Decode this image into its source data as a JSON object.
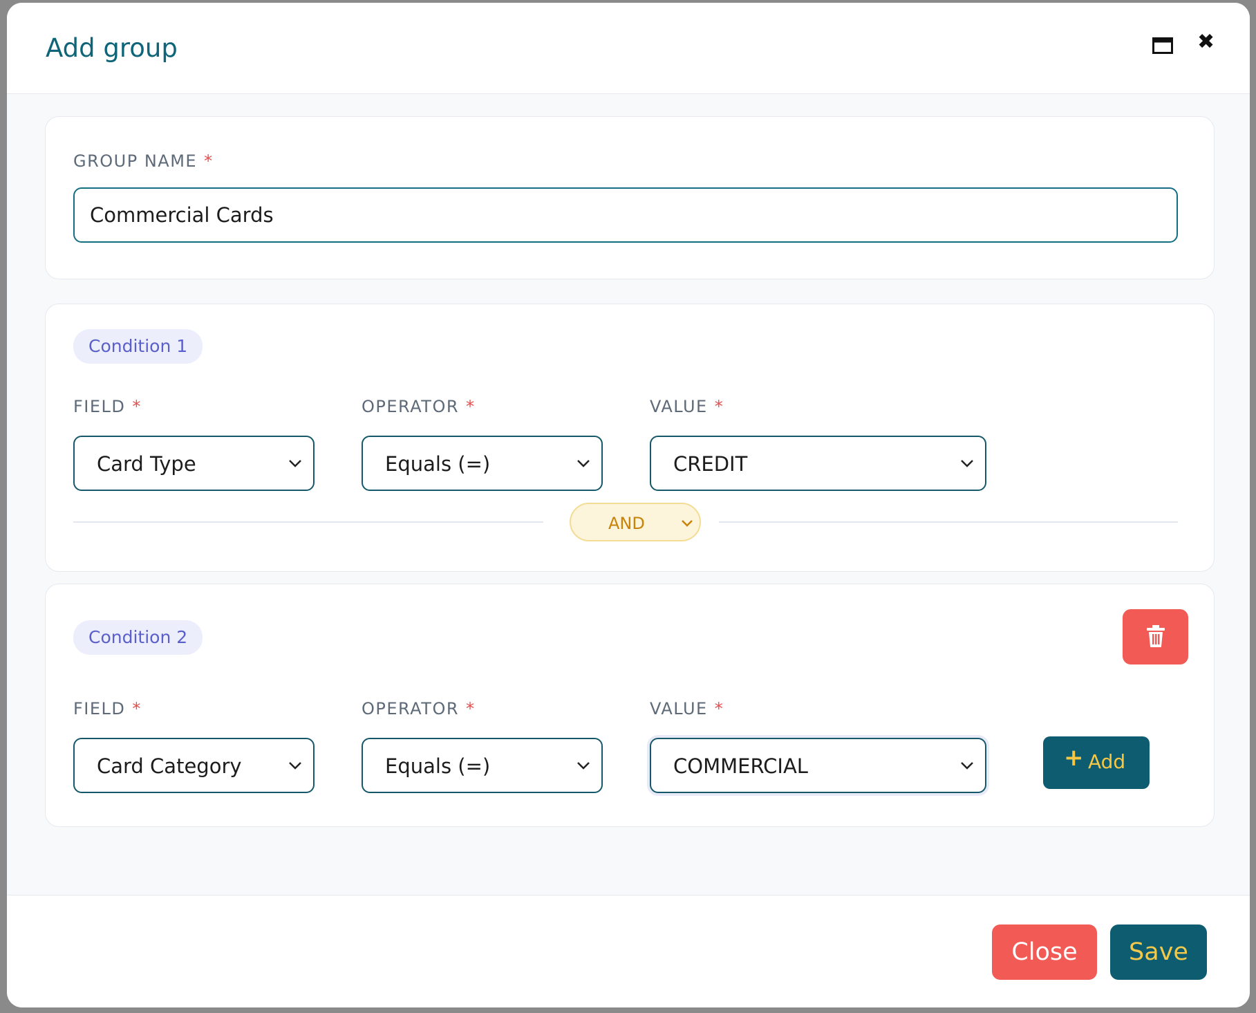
{
  "modal": {
    "title": "Add group",
    "maximize_icon": "window-maximize-icon",
    "close_icon": "close-x-icon"
  },
  "group": {
    "label": "GROUP NAME",
    "required_mark": "*",
    "value": "Commercial Cards"
  },
  "conditions": [
    {
      "badge": "Condition 1",
      "field_label": "FIELD",
      "operator_label": "OPERATOR",
      "value_label": "VALUE",
      "required_mark": "*",
      "field": "Card Type",
      "operator": "Equals (=)",
      "value": "CREDIT",
      "joiner": "AND"
    },
    {
      "badge": "Condition 2",
      "field_label": "FIELD",
      "operator_label": "OPERATOR",
      "value_label": "VALUE",
      "required_mark": "*",
      "field": "Card Category",
      "operator": "Equals (=)",
      "value": "COMMERCIAL",
      "add_label": "Add",
      "add_icon": "+",
      "delete_icon": "trash-icon"
    }
  ],
  "footer": {
    "close_label": "Close",
    "save_label": "Save"
  },
  "colors": {
    "primary": "#0e5c70",
    "danger": "#f25a55",
    "accent_yellow": "#f2c94c",
    "badge_text": "#5a5fc9"
  }
}
